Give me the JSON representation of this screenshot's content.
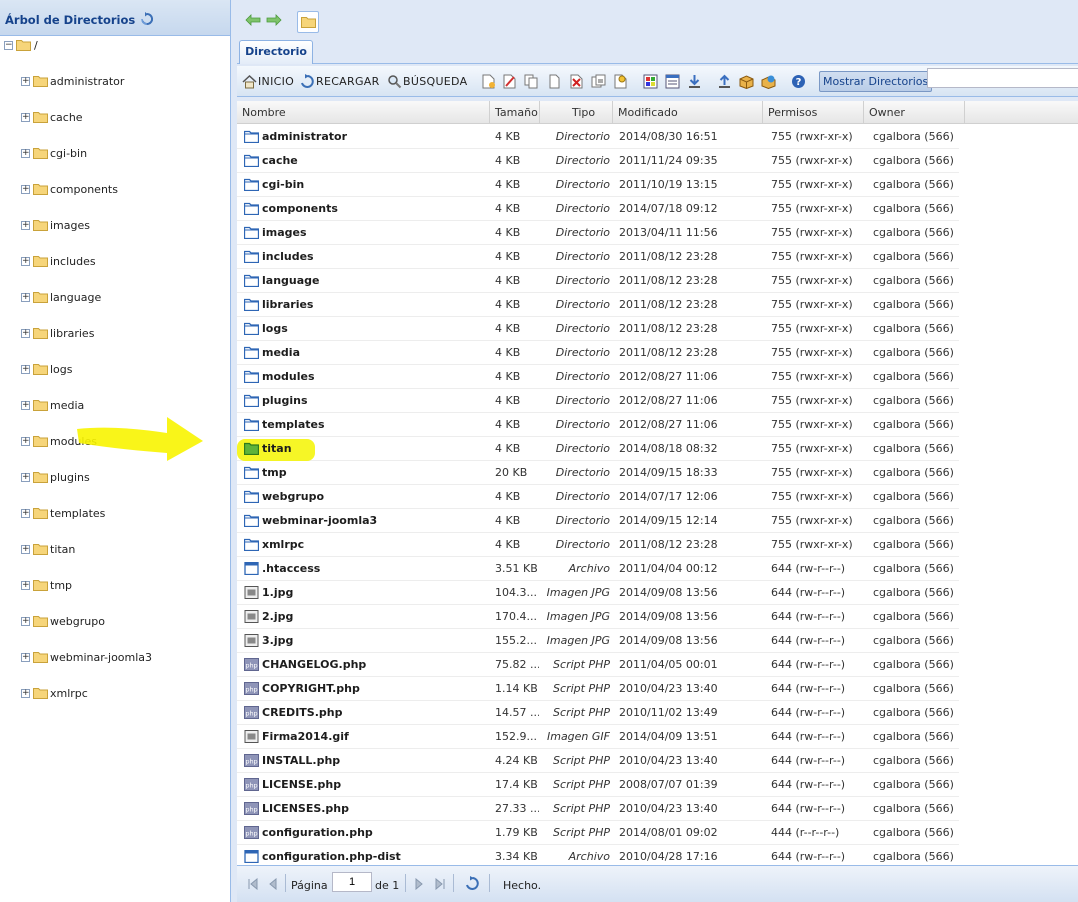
{
  "tree": {
    "title": "Árbol de Directorios",
    "root": "/",
    "items": [
      "administrator",
      "cache",
      "cgi-bin",
      "components",
      "images",
      "includes",
      "language",
      "libraries",
      "logs",
      "media",
      "modules",
      "plugins",
      "templates",
      "titan",
      "tmp",
      "webgrupo",
      "webminar-joomla3",
      "xmlrpc"
    ]
  },
  "tab": {
    "label": "Directorio"
  },
  "toolbar": {
    "home_label": "INICIO",
    "reload_label": "RECARGAR",
    "search_label": "BÚSQUEDA",
    "toggle_dirs_label": "Mostrar Directorios",
    "filter_value": ""
  },
  "grid": {
    "columns": [
      "Nombre",
      "Tamaño",
      "Tipo",
      "Modificado",
      "Permisos",
      "Owner"
    ],
    "rows": [
      {
        "name": "administrator",
        "size": "4 KB",
        "type": "Directorio",
        "modified": "2014/08/30 16:51",
        "perms": "755 (rwxr-xr-x)",
        "owner": "cgalbora (566)",
        "icon": "folder"
      },
      {
        "name": "cache",
        "size": "4 KB",
        "type": "Directorio",
        "modified": "2011/11/24 09:35",
        "perms": "755 (rwxr-xr-x)",
        "owner": "cgalbora (566)",
        "icon": "folder"
      },
      {
        "name": "cgi-bin",
        "size": "4 KB",
        "type": "Directorio",
        "modified": "2011/10/19 13:15",
        "perms": "755 (rwxr-xr-x)",
        "owner": "cgalbora (566)",
        "icon": "folder"
      },
      {
        "name": "components",
        "size": "4 KB",
        "type": "Directorio",
        "modified": "2014/07/18 09:12",
        "perms": "755 (rwxr-xr-x)",
        "owner": "cgalbora (566)",
        "icon": "folder"
      },
      {
        "name": "images",
        "size": "4 KB",
        "type": "Directorio",
        "modified": "2013/04/11 11:56",
        "perms": "755 (rwxr-xr-x)",
        "owner": "cgalbora (566)",
        "icon": "folder"
      },
      {
        "name": "includes",
        "size": "4 KB",
        "type": "Directorio",
        "modified": "2011/08/12 23:28",
        "perms": "755 (rwxr-xr-x)",
        "owner": "cgalbora (566)",
        "icon": "folder"
      },
      {
        "name": "language",
        "size": "4 KB",
        "type": "Directorio",
        "modified": "2011/08/12 23:28",
        "perms": "755 (rwxr-xr-x)",
        "owner": "cgalbora (566)",
        "icon": "folder"
      },
      {
        "name": "libraries",
        "size": "4 KB",
        "type": "Directorio",
        "modified": "2011/08/12 23:28",
        "perms": "755 (rwxr-xr-x)",
        "owner": "cgalbora (566)",
        "icon": "folder"
      },
      {
        "name": "logs",
        "size": "4 KB",
        "type": "Directorio",
        "modified": "2011/08/12 23:28",
        "perms": "755 (rwxr-xr-x)",
        "owner": "cgalbora (566)",
        "icon": "folder"
      },
      {
        "name": "media",
        "size": "4 KB",
        "type": "Directorio",
        "modified": "2011/08/12 23:28",
        "perms": "755 (rwxr-xr-x)",
        "owner": "cgalbora (566)",
        "icon": "folder"
      },
      {
        "name": "modules",
        "size": "4 KB",
        "type": "Directorio",
        "modified": "2012/08/27 11:06",
        "perms": "755 (rwxr-xr-x)",
        "owner": "cgalbora (566)",
        "icon": "folder"
      },
      {
        "name": "plugins",
        "size": "4 KB",
        "type": "Directorio",
        "modified": "2012/08/27 11:06",
        "perms": "755 (rwxr-xr-x)",
        "owner": "cgalbora (566)",
        "icon": "folder"
      },
      {
        "name": "templates",
        "size": "4 KB",
        "type": "Directorio",
        "modified": "2012/08/27 11:06",
        "perms": "755 (rwxr-xr-x)",
        "owner": "cgalbora (566)",
        "icon": "folder"
      },
      {
        "name": "titan",
        "size": "4 KB",
        "type": "Directorio",
        "modified": "2014/08/18 08:32",
        "perms": "755 (rwxr-xr-x)",
        "owner": "cgalbora (566)",
        "icon": "folder-green",
        "highlight": true
      },
      {
        "name": "tmp",
        "size": "20 KB",
        "type": "Directorio",
        "modified": "2014/09/15 18:33",
        "perms": "755 (rwxr-xr-x)",
        "owner": "cgalbora (566)",
        "icon": "folder"
      },
      {
        "name": "webgrupo",
        "size": "4 KB",
        "type": "Directorio",
        "modified": "2014/07/17 12:06",
        "perms": "755 (rwxr-xr-x)",
        "owner": "cgalbora (566)",
        "icon": "folder"
      },
      {
        "name": "webminar-joomla3",
        "size": "4 KB",
        "type": "Directorio",
        "modified": "2014/09/15 12:14",
        "perms": "755 (rwxr-xr-x)",
        "owner": "cgalbora (566)",
        "icon": "folder"
      },
      {
        "name": "xmlrpc",
        "size": "4 KB",
        "type": "Directorio",
        "modified": "2011/08/12 23:28",
        "perms": "755 (rwxr-xr-x)",
        "owner": "cgalbora (566)",
        "icon": "folder"
      },
      {
        "name": ".htaccess",
        "size": "3.51 KB",
        "type": "Archivo",
        "modified": "2011/04/04 00:12",
        "perms": "644 (rw-r--r--)",
        "owner": "cgalbora (566)",
        "icon": "file"
      },
      {
        "name": "1.jpg",
        "size": "104.3...",
        "type": "Imagen JPG",
        "modified": "2014/09/08 13:56",
        "perms": "644 (rw-r--r--)",
        "owner": "cgalbora (566)",
        "icon": "image"
      },
      {
        "name": "2.jpg",
        "size": "170.4...",
        "type": "Imagen JPG",
        "modified": "2014/09/08 13:56",
        "perms": "644 (rw-r--r--)",
        "owner": "cgalbora (566)",
        "icon": "image"
      },
      {
        "name": "3.jpg",
        "size": "155.2...",
        "type": "Imagen JPG",
        "modified": "2014/09/08 13:56",
        "perms": "644 (rw-r--r--)",
        "owner": "cgalbora (566)",
        "icon": "image"
      },
      {
        "name": "CHANGELOG.php",
        "size": "75.82 ...",
        "type": "Script PHP",
        "modified": "2011/04/05 00:01",
        "perms": "644 (rw-r--r--)",
        "owner": "cgalbora (566)",
        "icon": "php"
      },
      {
        "name": "COPYRIGHT.php",
        "size": "1.14 KB",
        "type": "Script PHP",
        "modified": "2010/04/23 13:40",
        "perms": "644 (rw-r--r--)",
        "owner": "cgalbora (566)",
        "icon": "php"
      },
      {
        "name": "CREDITS.php",
        "size": "14.57 ...",
        "type": "Script PHP",
        "modified": "2010/11/02 13:49",
        "perms": "644 (rw-r--r--)",
        "owner": "cgalbora (566)",
        "icon": "php"
      },
      {
        "name": "Firma2014.gif",
        "size": "152.9...",
        "type": "Imagen GIF",
        "modified": "2014/04/09 13:51",
        "perms": "644 (rw-r--r--)",
        "owner": "cgalbora (566)",
        "icon": "image"
      },
      {
        "name": "INSTALL.php",
        "size": "4.24 KB",
        "type": "Script PHP",
        "modified": "2010/04/23 13:40",
        "perms": "644 (rw-r--r--)",
        "owner": "cgalbora (566)",
        "icon": "php"
      },
      {
        "name": "LICENSE.php",
        "size": "17.4 KB",
        "type": "Script PHP",
        "modified": "2008/07/07 01:39",
        "perms": "644 (rw-r--r--)",
        "owner": "cgalbora (566)",
        "icon": "php"
      },
      {
        "name": "LICENSES.php",
        "size": "27.33 ...",
        "type": "Script PHP",
        "modified": "2010/04/23 13:40",
        "perms": "644 (rw-r--r--)",
        "owner": "cgalbora (566)",
        "icon": "php"
      },
      {
        "name": "configuration.php",
        "size": "1.79 KB",
        "type": "Script PHP",
        "modified": "2014/08/01 09:02",
        "perms": "444 (r--r--r--)",
        "owner": "cgalbora (566)",
        "icon": "php"
      },
      {
        "name": "configuration.php-dist",
        "size": "3.34 KB",
        "type": "Archivo",
        "modified": "2010/04/28 17:16",
        "perms": "644 (rw-r--r--)",
        "owner": "cgalbora (566)",
        "icon": "file"
      }
    ]
  },
  "paging": {
    "page_label": "Página",
    "page_value": "1",
    "of_label": "de 1",
    "status": "Hecho."
  },
  "colors": {
    "accent": "#15428b",
    "folder": "#f3c451",
    "folder_green": "#4aa02c",
    "highlight": "#f5f500"
  }
}
